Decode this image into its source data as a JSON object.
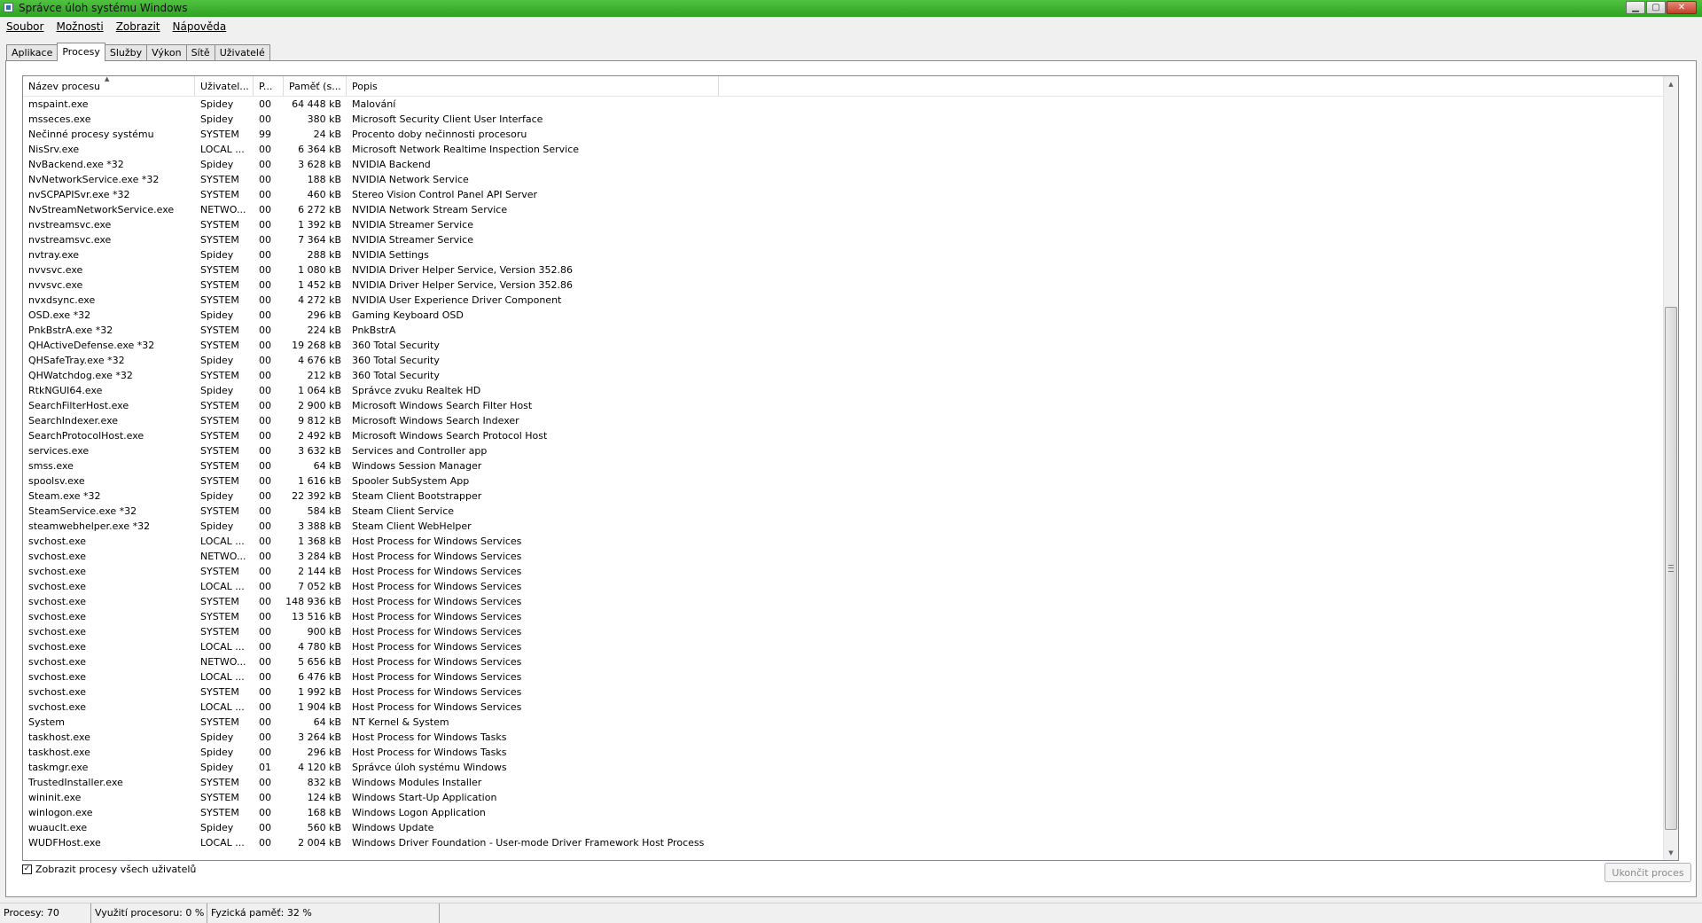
{
  "window": {
    "title": "Správce úloh systému Windows"
  },
  "menu": [
    "Soubor",
    "Možnosti",
    "Zobrazit",
    "Nápověda"
  ],
  "tabs": [
    {
      "label": "Aplikace",
      "active": false
    },
    {
      "label": "Procesy",
      "active": true
    },
    {
      "label": "Služby",
      "active": false
    },
    {
      "label": "Výkon",
      "active": false
    },
    {
      "label": "Sítě",
      "active": false
    },
    {
      "label": "Uživatelé",
      "active": false
    }
  ],
  "columns": [
    "Název procesu",
    "Uživatel...",
    "P...",
    "Paměť (s...",
    "Popis"
  ],
  "processes": [
    [
      "mspaint.exe",
      "Spidey",
      "00",
      "64 448 kB",
      "Malování"
    ],
    [
      "msseces.exe",
      "Spidey",
      "00",
      "380 kB",
      "Microsoft Security Client User Interface"
    ],
    [
      "Nečinné procesy systému",
      "SYSTEM",
      "99",
      "24 kB",
      "Procento doby nečinnosti procesoru"
    ],
    [
      "NisSrv.exe",
      "LOCAL ...",
      "00",
      "6 364 kB",
      "Microsoft Network Realtime Inspection Service"
    ],
    [
      "NvBackend.exe *32",
      "Spidey",
      "00",
      "3 628 kB",
      "NVIDIA Backend"
    ],
    [
      "NvNetworkService.exe *32",
      "SYSTEM",
      "00",
      "188 kB",
      "NVIDIA Network Service"
    ],
    [
      "nvSCPAPISvr.exe *32",
      "SYSTEM",
      "00",
      "460 kB",
      "Stereo Vision Control Panel API Server"
    ],
    [
      "NvStreamNetworkService.exe",
      "NETWO...",
      "00",
      "6 272 kB",
      "NVIDIA Network Stream Service"
    ],
    [
      "nvstreamsvc.exe",
      "SYSTEM",
      "00",
      "1 392 kB",
      "NVIDIA Streamer Service"
    ],
    [
      "nvstreamsvc.exe",
      "SYSTEM",
      "00",
      "7 364 kB",
      "NVIDIA Streamer Service"
    ],
    [
      "nvtray.exe",
      "Spidey",
      "00",
      "288 kB",
      "NVIDIA Settings"
    ],
    [
      "nvvsvc.exe",
      "SYSTEM",
      "00",
      "1 080 kB",
      "NVIDIA Driver Helper Service, Version 352.86"
    ],
    [
      "nvvsvc.exe",
      "SYSTEM",
      "00",
      "1 452 kB",
      "NVIDIA Driver Helper Service, Version 352.86"
    ],
    [
      "nvxdsync.exe",
      "SYSTEM",
      "00",
      "4 272 kB",
      "NVIDIA User Experience Driver Component"
    ],
    [
      "OSD.exe *32",
      "Spidey",
      "00",
      "296 kB",
      "Gaming Keyboard OSD"
    ],
    [
      "PnkBstrA.exe *32",
      "SYSTEM",
      "00",
      "224 kB",
      "PnkBstrA"
    ],
    [
      "QHActiveDefense.exe *32",
      "SYSTEM",
      "00",
      "19 268 kB",
      "360 Total Security"
    ],
    [
      "QHSafeTray.exe *32",
      "Spidey",
      "00",
      "4 676 kB",
      "360 Total Security"
    ],
    [
      "QHWatchdog.exe *32",
      "SYSTEM",
      "00",
      "212 kB",
      "360 Total Security"
    ],
    [
      "RtkNGUI64.exe",
      "Spidey",
      "00",
      "1 064 kB",
      "Správce zvuku Realtek HD"
    ],
    [
      "SearchFilterHost.exe",
      "SYSTEM",
      "00",
      "2 900 kB",
      "Microsoft Windows Search Filter Host"
    ],
    [
      "SearchIndexer.exe",
      "SYSTEM",
      "00",
      "9 812 kB",
      "Microsoft Windows Search Indexer"
    ],
    [
      "SearchProtocolHost.exe",
      "SYSTEM",
      "00",
      "2 492 kB",
      "Microsoft Windows Search Protocol Host"
    ],
    [
      "services.exe",
      "SYSTEM",
      "00",
      "3 632 kB",
      "Services and Controller app"
    ],
    [
      "smss.exe",
      "SYSTEM",
      "00",
      "64 kB",
      "Windows Session Manager"
    ],
    [
      "spoolsv.exe",
      "SYSTEM",
      "00",
      "1 616 kB",
      "Spooler SubSystem App"
    ],
    [
      "Steam.exe *32",
      "Spidey",
      "00",
      "22 392 kB",
      "Steam Client Bootstrapper"
    ],
    [
      "SteamService.exe *32",
      "SYSTEM",
      "00",
      "584 kB",
      "Steam Client Service"
    ],
    [
      "steamwebhelper.exe *32",
      "Spidey",
      "00",
      "3 388 kB",
      "Steam Client WebHelper"
    ],
    [
      "svchost.exe",
      "LOCAL ...",
      "00",
      "1 368 kB",
      "Host Process for Windows Services"
    ],
    [
      "svchost.exe",
      "NETWO...",
      "00",
      "3 284 kB",
      "Host Process for Windows Services"
    ],
    [
      "svchost.exe",
      "SYSTEM",
      "00",
      "2 144 kB",
      "Host Process for Windows Services"
    ],
    [
      "svchost.exe",
      "LOCAL ...",
      "00",
      "7 052 kB",
      "Host Process for Windows Services"
    ],
    [
      "svchost.exe",
      "SYSTEM",
      "00",
      "148 936 kB",
      "Host Process for Windows Services"
    ],
    [
      "svchost.exe",
      "SYSTEM",
      "00",
      "13 516 kB",
      "Host Process for Windows Services"
    ],
    [
      "svchost.exe",
      "SYSTEM",
      "00",
      "900 kB",
      "Host Process for Windows Services"
    ],
    [
      "svchost.exe",
      "LOCAL ...",
      "00",
      "4 780 kB",
      "Host Process for Windows Services"
    ],
    [
      "svchost.exe",
      "NETWO...",
      "00",
      "5 656 kB",
      "Host Process for Windows Services"
    ],
    [
      "svchost.exe",
      "LOCAL ...",
      "00",
      "6 476 kB",
      "Host Process for Windows Services"
    ],
    [
      "svchost.exe",
      "SYSTEM",
      "00",
      "1 992 kB",
      "Host Process for Windows Services"
    ],
    [
      "svchost.exe",
      "LOCAL ...",
      "00",
      "1 904 kB",
      "Host Process for Windows Services"
    ],
    [
      "System",
      "SYSTEM",
      "00",
      "64 kB",
      "NT Kernel & System"
    ],
    [
      "taskhost.exe",
      "Spidey",
      "00",
      "3 264 kB",
      "Host Process for Windows Tasks"
    ],
    [
      "taskhost.exe",
      "Spidey",
      "00",
      "296 kB",
      "Host Process for Windows Tasks"
    ],
    [
      "taskmgr.exe",
      "Spidey",
      "01",
      "4 120 kB",
      "Správce úloh systému Windows"
    ],
    [
      "TrustedInstaller.exe",
      "SYSTEM",
      "00",
      "832 kB",
      "Windows Modules Installer"
    ],
    [
      "wininit.exe",
      "SYSTEM",
      "00",
      "124 kB",
      "Windows Start-Up Application"
    ],
    [
      "winlogon.exe",
      "SYSTEM",
      "00",
      "168 kB",
      "Windows Logon Application"
    ],
    [
      "wuauclt.exe",
      "Spidey",
      "00",
      "560 kB",
      "Windows Update"
    ],
    [
      "WUDFHost.exe",
      "LOCAL ...",
      "00",
      "2 004 kB",
      "Windows Driver Foundation - User-mode Driver Framework Host Process"
    ]
  ],
  "show_all_users": {
    "label": "Zobrazit procesy všech uživatelů",
    "checked": true
  },
  "end_process_button": "Ukončit proces",
  "status": {
    "processes": "Procesy: 70",
    "cpu": "Využití procesoru: 0 %",
    "memory": "Fyzická paměť: 32 %"
  },
  "icons": {
    "app": "task-manager-icon",
    "minimize": "minimize-icon",
    "maximize": "maximize-icon",
    "close": "close-icon"
  }
}
